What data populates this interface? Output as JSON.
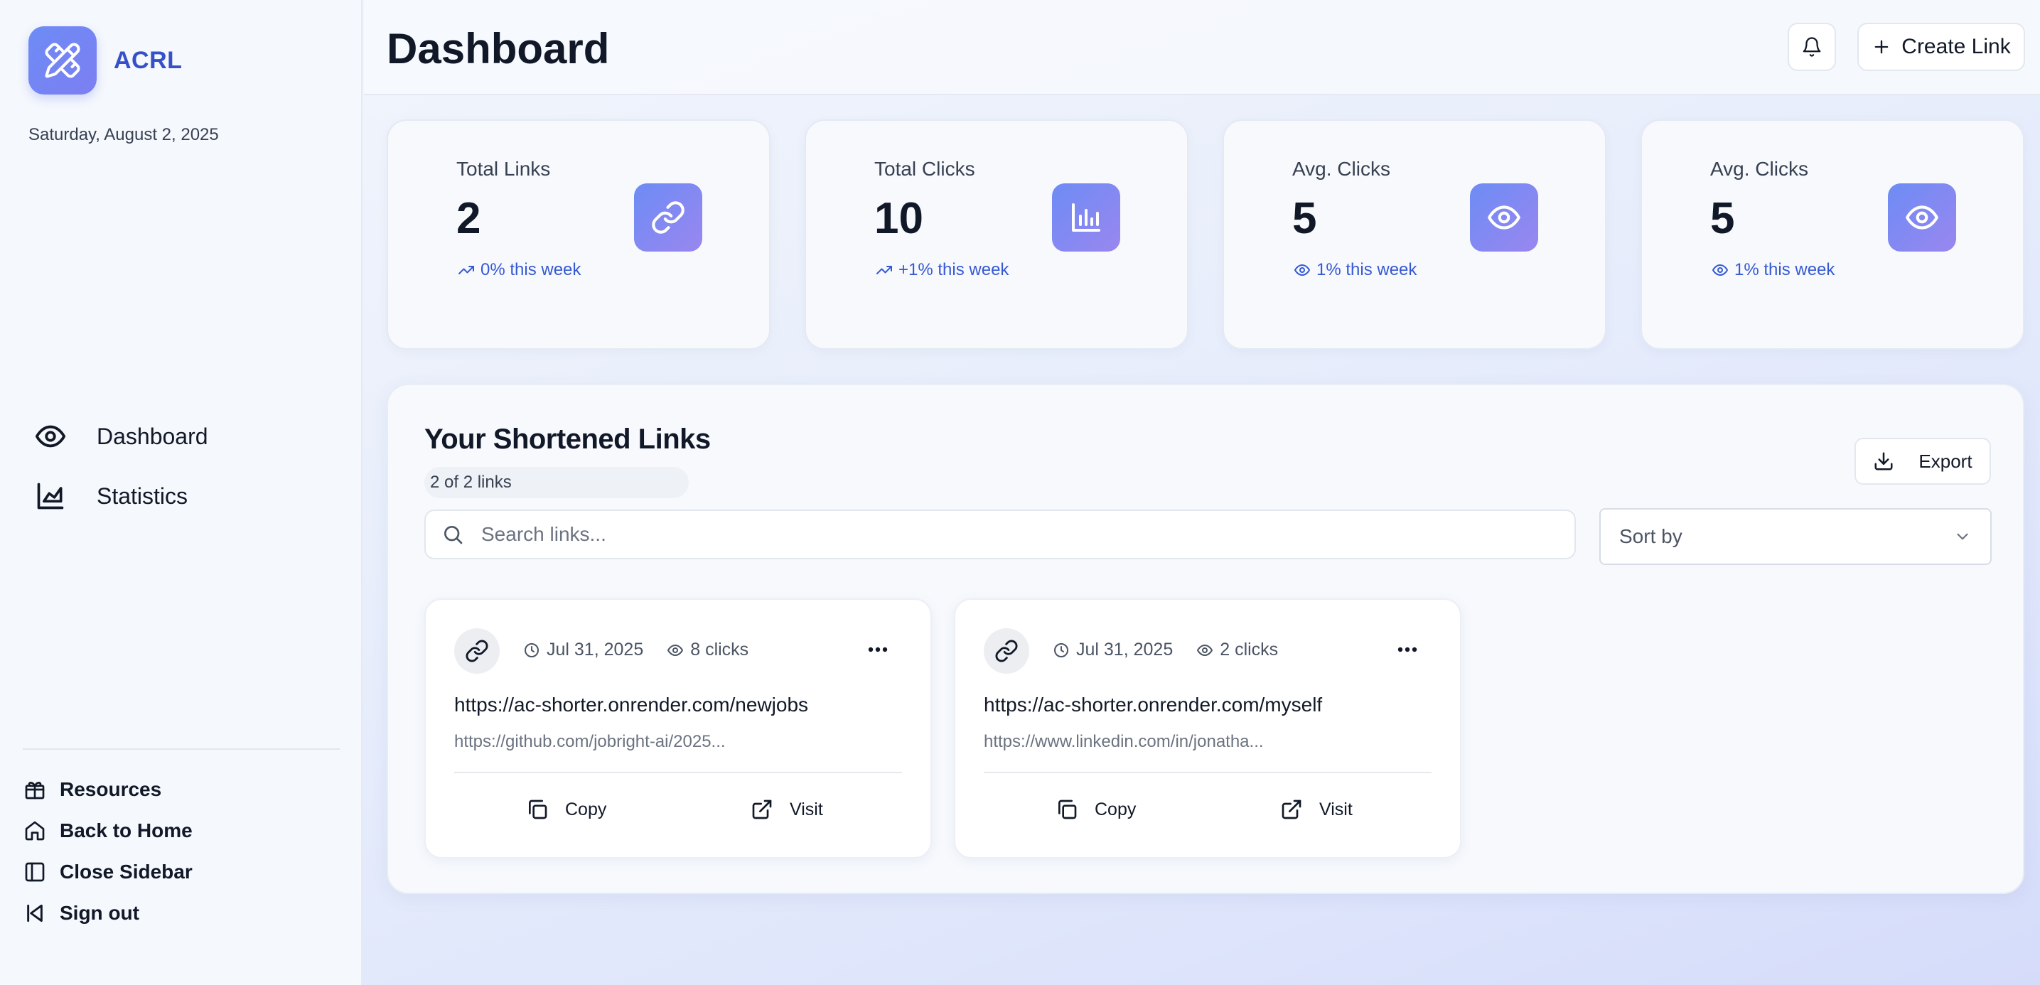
{
  "brand": {
    "name": "ACRL",
    "logo_icon": "pencil-ruler-icon"
  },
  "date": "Saturday, August 2, 2025",
  "sidebar": {
    "nav": [
      {
        "label": "Dashboard",
        "icon": "eye-icon"
      },
      {
        "label": "Statistics",
        "icon": "area-chart-icon"
      }
    ],
    "bottom": [
      {
        "label": "Resources",
        "icon": "package-icon"
      },
      {
        "label": "Back to Home",
        "icon": "home-icon"
      },
      {
        "label": "Close Sidebar",
        "icon": "panel-left-icon"
      },
      {
        "label": "Sign out",
        "icon": "skip-back-icon"
      }
    ]
  },
  "header": {
    "title": "Dashboard",
    "create_label": "Create Link"
  },
  "stats": [
    {
      "label": "Total Links",
      "value": "2",
      "trend": "0% this week",
      "icon": "link-icon",
      "trend_icon": "trending-up-icon"
    },
    {
      "label": "Total Clicks",
      "value": "10",
      "trend": "+1% this week",
      "icon": "bar-chart-icon",
      "trend_icon": "trending-up-icon"
    },
    {
      "label": "Avg. Clicks",
      "value": "5",
      "trend": "1% this week",
      "icon": "eye-icon",
      "trend_icon": "eye-icon"
    },
    {
      "label": "Avg. Clicks",
      "value": "5",
      "trend": "1% this week",
      "icon": "eye-icon",
      "trend_icon": "eye-icon"
    }
  ],
  "links_panel": {
    "title": "Your Shortened Links",
    "count": "2 of 2 links",
    "export_label": "Export",
    "search_placeholder": "Search links...",
    "sort_label": "Sort by",
    "links": [
      {
        "date": "Jul 31, 2025",
        "clicks": "8 clicks",
        "short_url": "https://ac-shorter.onrender.com/newjobs",
        "original_url": "https://github.com/jobright-ai/2025...",
        "copy_label": "Copy",
        "visit_label": "Visit"
      },
      {
        "date": "Jul 31, 2025",
        "clicks": "2 clicks",
        "short_url": "https://ac-shorter.onrender.com/myself",
        "original_url": "https://www.linkedin.com/in/jonatha...",
        "copy_label": "Copy",
        "visit_label": "Visit"
      }
    ]
  },
  "colors": {
    "accent": "#3550c9",
    "trend": "#3559d3",
    "gradient_start": "#6d8cf5",
    "gradient_end": "#9a86ef"
  }
}
